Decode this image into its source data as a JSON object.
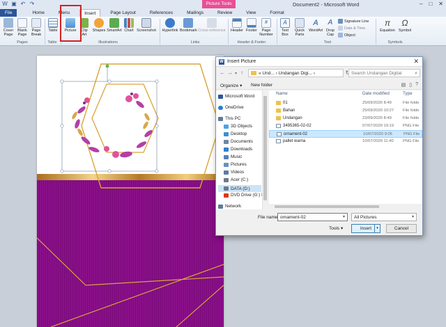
{
  "title_bar": {
    "context_tab": "Picture Tools",
    "document_title": "Document2 - Microsoft Word",
    "controls": [
      "–",
      "□",
      "✕"
    ]
  },
  "ribbon_tabs": [
    "File",
    "Home",
    "Menu",
    "Insert",
    "Page Layout",
    "References",
    "Mailings",
    "Review",
    "View",
    "Format"
  ],
  "ribbon": {
    "pages": {
      "cover": "Cover\nPage",
      "blank": "Blank\nPage",
      "break": "Page\nBreak",
      "group": "Pages"
    },
    "tables": {
      "table": "Table",
      "group": "Table"
    },
    "illustrations": {
      "picture": "Picture",
      "clipart": "Clip\nArt",
      "shapes": "Shapes",
      "smartart": "SmartArt",
      "chart": "Chart",
      "screenshot": "Screenshot",
      "group": "Illustrations"
    },
    "links": {
      "hyperlink": "Hyperlink",
      "bookmark": "Bookmark",
      "crossref": "Cross-reference",
      "group": "Links"
    },
    "header_footer": {
      "header": "Header",
      "footer": "Footer",
      "page_number": "Page\nNumber",
      "group": "Header & Footer"
    },
    "text": {
      "textbox": "Text\nBox",
      "quickparts": "Quick\nParts",
      "wordart": "WordArt",
      "dropcap": "Drop\nCap",
      "signature": "Signature Line",
      "datetime": "Date & Time",
      "object": "Object",
      "group": "Text"
    },
    "symbols": {
      "equation": "Equation",
      "symbol": "Symbol",
      "group": "Symbols"
    }
  },
  "dialog": {
    "title": "Insert Picture",
    "address": "« Und... › Undangan Digi... ›",
    "search_placeholder": "Search Undangan Digital",
    "organize": "Organize ▾",
    "new_folder": "New folder",
    "nav_items": [
      {
        "label": "Microsoft Word",
        "color": "#2a5699"
      },
      {
        "label": "OneDrive",
        "color": "#2b7cd3"
      },
      {
        "label": "This PC",
        "color": "#5d7a99"
      },
      {
        "label": "3D Objects",
        "color": "#4aa3df"
      },
      {
        "label": "Desktop",
        "color": "#3b8fd9"
      },
      {
        "label": "Documents",
        "color": "#6f86a3"
      },
      {
        "label": "Downloads",
        "color": "#2f7fd0"
      },
      {
        "label": "Music",
        "color": "#5780b5"
      },
      {
        "label": "Pictures",
        "color": "#6a8fc0"
      },
      {
        "label": "Videos",
        "color": "#5b7ca6"
      },
      {
        "label": "Acer (C:)",
        "color": "#6a7a8c"
      },
      {
        "label": "DATA (D:)",
        "color": "#6a7a8c"
      },
      {
        "label": "DVD Drive (G:) M",
        "color": "#d83b01"
      },
      {
        "label": "Network",
        "color": "#5d7a99"
      }
    ],
    "columns": {
      "name": "Name",
      "date": "Date modified",
      "type": "Type"
    },
    "files": [
      {
        "name": "01",
        "date": "25/09/2020 8:49",
        "type": "File folde",
        "kind": "folder"
      },
      {
        "name": "Bahan",
        "date": "25/09/2020 10:27",
        "type": "File folde",
        "kind": "folder"
      },
      {
        "name": "Undangan",
        "date": "23/09/2020 8:49",
        "type": "File folde",
        "kind": "folder"
      },
      {
        "name": "3495365-02-02",
        "date": "07/07/2020 19:19",
        "type": "PNG File",
        "kind": "png"
      },
      {
        "name": "ornament-02",
        "date": "10/07/2020 9:05",
        "type": "PNG File",
        "kind": "png"
      },
      {
        "name": "pallet warna",
        "date": "10/07/2020 11:40",
        "type": "PNG File",
        "kind": "png"
      }
    ],
    "selected_file": "ornament-02",
    "file_name_label": "File name:",
    "file_name_value": "ornament-02",
    "file_type": "All Pictures",
    "tools": "Tools",
    "insert": "Insert",
    "cancel": "Cancel"
  },
  "colors": {
    "ribbon_file": "#2a5699",
    "context_tab": "#e84f95",
    "highlight": "#d62020",
    "purple": "#8a1089",
    "gold": "#d9a53a"
  }
}
